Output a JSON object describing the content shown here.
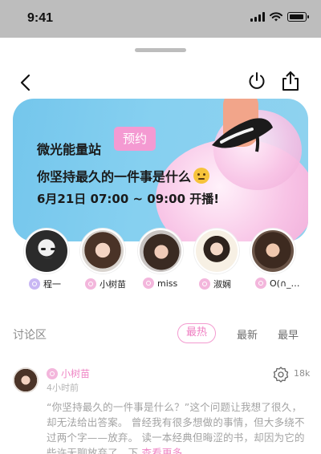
{
  "status_bar": {
    "time": "9:41"
  },
  "banner": {
    "label": "微光能量站",
    "reserve_button": "预约",
    "question": "你坚持最久的一件事是什么",
    "schedule": "6月21日 07:00 ~ 09:00 开播!",
    "colors": {
      "background": "#86d0f0",
      "accent": "#f49ad2"
    }
  },
  "hosts": [
    {
      "name": "程一",
      "badge": "purple"
    },
    {
      "name": "小树苗",
      "badge": "pink"
    },
    {
      "name": "miss",
      "badge": "pink"
    },
    {
      "name": "淑娴",
      "badge": "pink"
    },
    {
      "name": "O(∩_…",
      "badge": "pink"
    }
  ],
  "discussion": {
    "title": "讨论区",
    "sort_options": [
      "最热",
      "最新",
      "最早"
    ],
    "active_sort": "最热"
  },
  "comment": {
    "user": "小树苗",
    "time": "4小时前",
    "likes": "18k",
    "text": "“你坚持最久的一件事是什么？”这个问题让我想了很久，却无法给出答案。 曾经我有很多想做的事情，但大多绕不过两个字——放弃。 读一本经典但晦涩的书，却因为它的些许无聊放弃了，下",
    "more": "查看更多"
  },
  "icons": [
    "back-icon",
    "power-icon",
    "share-icon",
    "like-icon",
    "signal-icon",
    "wifi-icon",
    "battery-icon"
  ]
}
